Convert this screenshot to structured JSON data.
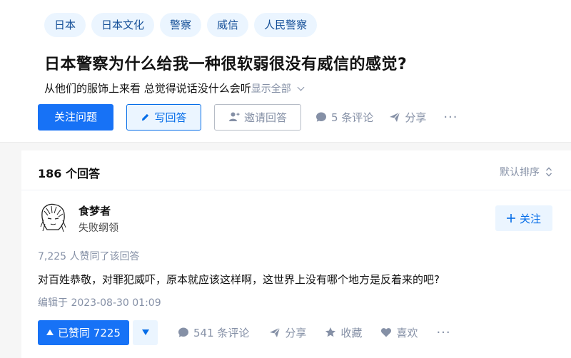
{
  "question": {
    "tags": [
      "日本",
      "日本文化",
      "警察",
      "威信",
      "人民警察"
    ],
    "title": "日本警察为什么给我一种很软弱很没有威信的感觉?",
    "detail": "从他们的服饰上来看 总觉得说话没什么会听",
    "show_all": "显示全部",
    "actions": {
      "follow": "关注问题",
      "write": "写回答",
      "invite": "邀请回答",
      "comments": "5 条评论",
      "share": "分享",
      "more": "···"
    }
  },
  "answers": {
    "count_label": "186 个回答",
    "sort_label": "默认排序",
    "answer": {
      "author_name": "食梦者",
      "author_bio": "失败纲领",
      "follow_label": "关注",
      "vote_summary": "7,225 人赞同了该回答",
      "content": "对百姓恭敬，对罪犯威吓，原本就应该这样啊，这世界上没有哪个地方是反着来的吧?",
      "edited": "编辑于 2023-08-30 01:09",
      "actions": {
        "voted": "已赞同 7225",
        "comments": "541 条评论",
        "share": "分享",
        "favorite": "收藏",
        "like": "喜欢",
        "more": "···"
      }
    }
  },
  "colors": {
    "primary": "#1772f6",
    "tag_bg": "#ebf5ff",
    "tag_text": "#175199",
    "muted": "#8590a6"
  },
  "icons": {
    "write": "pencil-icon",
    "invite": "add-user-icon",
    "comment": "comment-bubble-icon",
    "share": "paper-plane-icon",
    "favorite": "star-icon",
    "like": "heart-icon",
    "sort": "sort-arrows-icon",
    "vote_up": "triangle-up-icon",
    "vote_down": "triangle-down-icon",
    "follow_plus": "plus-icon"
  }
}
